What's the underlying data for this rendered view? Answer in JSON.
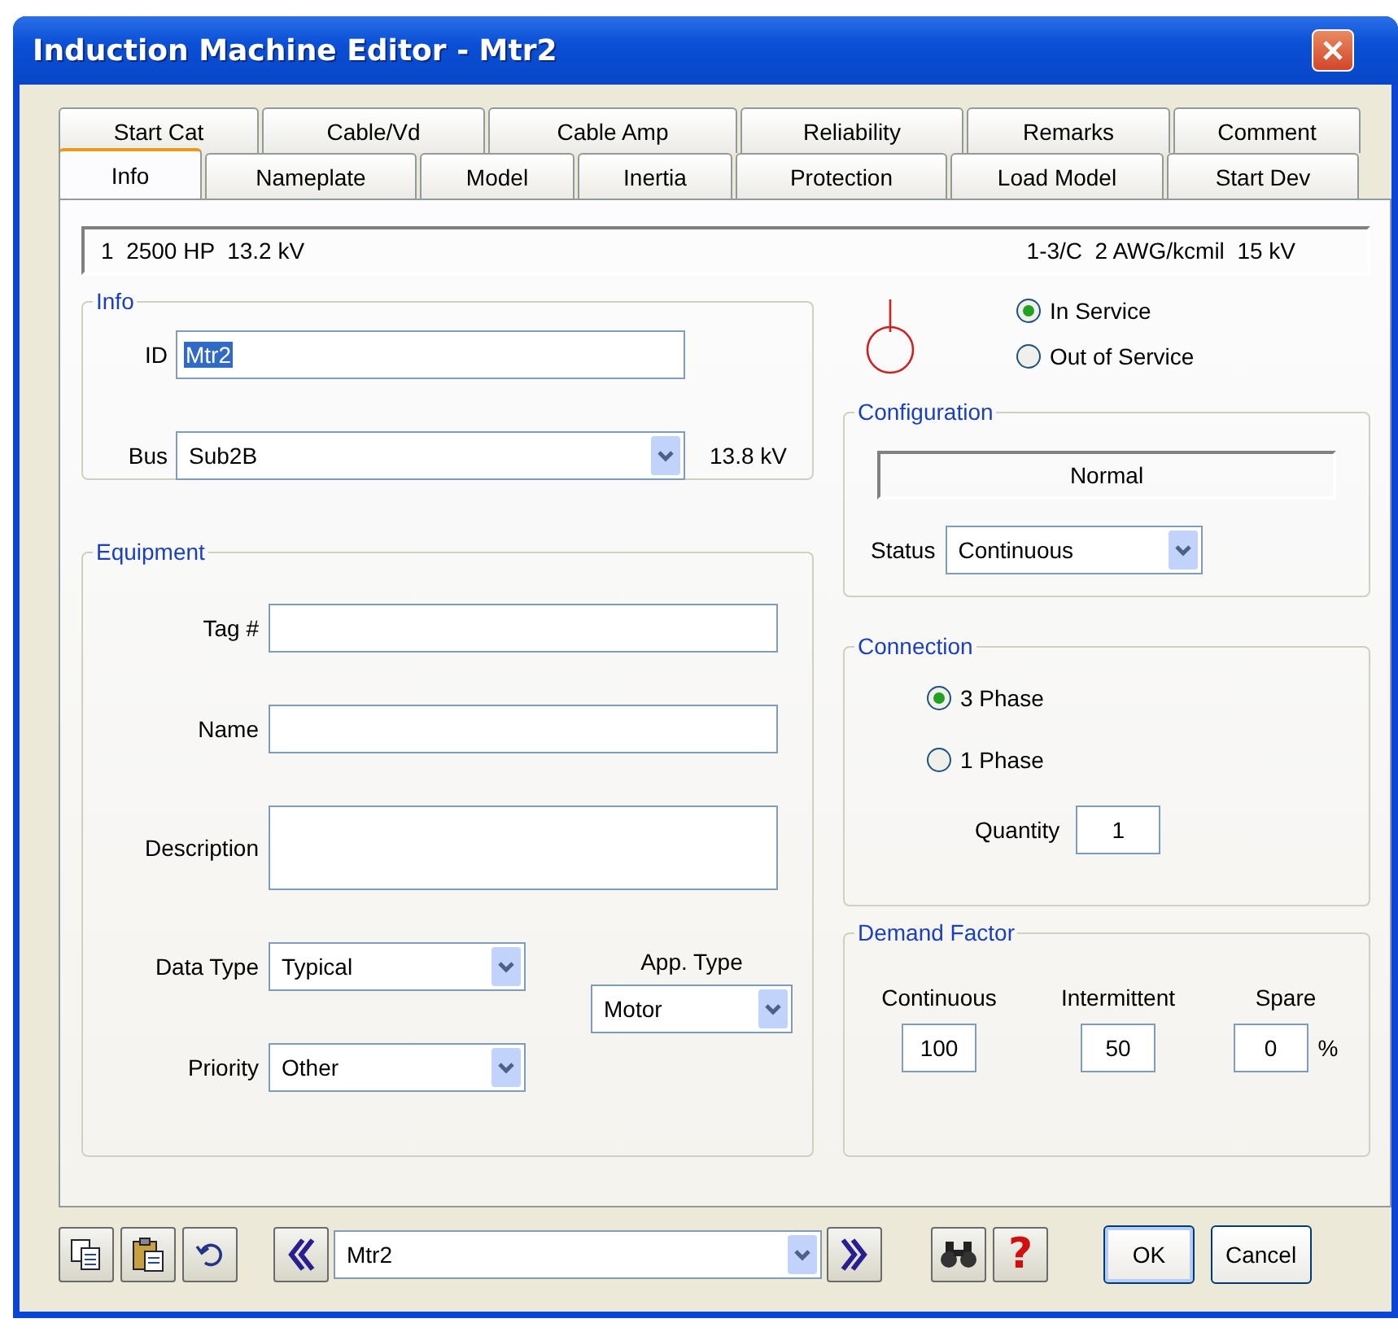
{
  "window": {
    "title": "Induction Machine Editor - Mtr2"
  },
  "tabs": {
    "back_row": [
      {
        "label": "Start Cat",
        "selected": false
      },
      {
        "label": "Cable/Vd",
        "selected": false
      },
      {
        "label": "Cable Amp",
        "selected": false
      },
      {
        "label": "Reliability",
        "selected": false
      },
      {
        "label": "Remarks",
        "selected": false
      },
      {
        "label": "Comment",
        "selected": false
      }
    ],
    "front_row": [
      {
        "label": "Info",
        "selected": true
      },
      {
        "label": "Nameplate",
        "selected": false
      },
      {
        "label": "Model",
        "selected": false
      },
      {
        "label": "Inertia",
        "selected": false
      },
      {
        "label": "Protection",
        "selected": false
      },
      {
        "label": "Load Model",
        "selected": false
      },
      {
        "label": "Start Dev",
        "selected": false
      }
    ]
  },
  "summary": {
    "left": "1  2500 HP  13.2 kV",
    "right": "1-3/C  2 AWG/kcmil  15 kV"
  },
  "info": {
    "legend": "Info",
    "id_label": "ID",
    "id_value": "Mtr2",
    "bus_label": "Bus",
    "bus_value": "Sub2B",
    "bus_voltage": "13.8 kV"
  },
  "service": [
    {
      "label": "In Service",
      "selected": true
    },
    {
      "label": "Out of Service",
      "selected": false
    }
  ],
  "configuration": {
    "legend": "Configuration",
    "value": "Normal",
    "status_label": "Status",
    "status_value": "Continuous"
  },
  "equipment": {
    "legend": "Equipment",
    "fields": [
      {
        "label": "Tag #",
        "kind": "line"
      },
      {
        "label": "Name",
        "kind": "line"
      },
      {
        "label": "Description",
        "kind": "area"
      }
    ],
    "data_type_label": "Data Type",
    "data_type_value": "Typical",
    "priority_label": "Priority",
    "priority_value": "Other",
    "app_type_label": "App. Type",
    "app_type_value": "Motor"
  },
  "connection": {
    "legend": "Connection",
    "options": [
      {
        "label": "3 Phase",
        "selected": true
      },
      {
        "label": "1 Phase",
        "selected": false
      }
    ],
    "quantity_label": "Quantity",
    "quantity_value": "1"
  },
  "demand_factor": {
    "legend": "Demand Factor",
    "columns": [
      {
        "label": "Continuous",
        "value": "100"
      },
      {
        "label": "Intermittent",
        "value": "50"
      },
      {
        "label": "Spare",
        "value": "0"
      }
    ],
    "unit": "%"
  },
  "footer": {
    "nav_value": "Mtr2",
    "help": "?",
    "buttons": [
      "OK",
      "Cancel"
    ]
  }
}
